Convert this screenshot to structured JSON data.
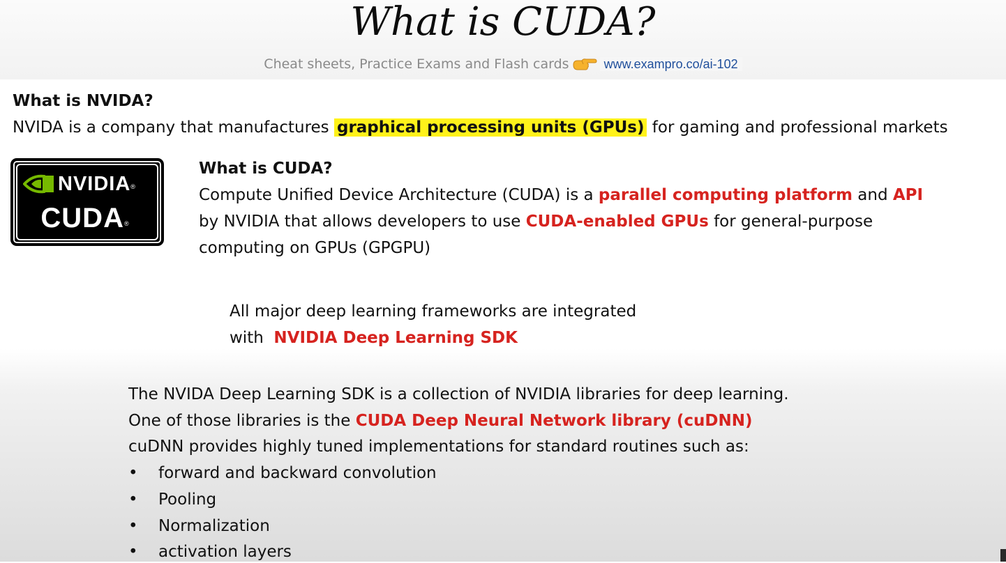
{
  "header": {
    "title": "What is CUDA?",
    "promo_text": "Cheat sheets, Practice Exams and Flash cards",
    "promo_icon": "pointing-hand-icon",
    "promo_link": "www.exampro.co/ai-102"
  },
  "nvidia_section": {
    "heading": "What is NVIDA?",
    "text_before": "NVIDA is a company that manufactures",
    "highlight": "graphical processing units (GPUs)",
    "text_after": "for gaming and professional markets",
    "highlight_color": "#fff21a"
  },
  "logo": {
    "brand": "NVIDIA",
    "product": "CUDA",
    "registered": "®",
    "eye_color": "#76b900"
  },
  "cuda_section": {
    "heading": "What is CUDA?",
    "l1_a": "Compute Unified Device Architecture (CUDA) is a",
    "l1_b": "parallel computing platform",
    "l1_c": "and",
    "l1_d": "API",
    "l2_a": "by NVIDIA that allows developers to use",
    "l2_b": "CUDA-enabled GPUs",
    "l2_c": "for general-purpose",
    "l3": "computing on GPUs (GPGPU)"
  },
  "frameworks": {
    "l1": "All major deep learning frameworks are integrated",
    "l2_a": "with",
    "l2_b": "NVIDIA Deep Learning SDK"
  },
  "sdk_section": {
    "l1": "The NVIDA Deep Learning SDK is a collection of NVIDIA libraries for deep learning.",
    "l2_a": "One of those libraries is the",
    "l2_b": "CUDA Deep Neural Network library (cuDNN)",
    "l3": "cuDNN provides highly tuned implementations for standard routines such as:",
    "bullet_char": "•",
    "bullets": [
      "forward and backward convolution",
      "Pooling",
      "Normalization",
      "activation layers"
    ]
  },
  "colors": {
    "accent_red": "#d6231f",
    "link_blue": "#1f4f9c"
  }
}
